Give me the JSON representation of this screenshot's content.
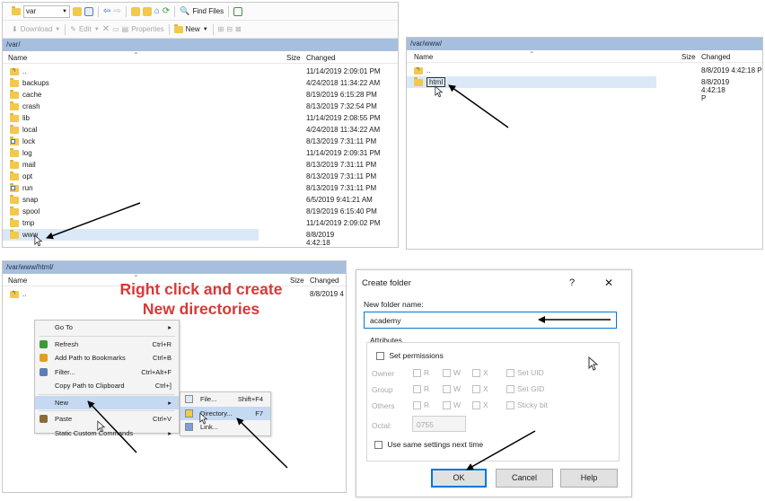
{
  "panel1": {
    "toolbar1": {
      "path_combo": "var",
      "find_files": "Find Files"
    },
    "toolbar2": {
      "download": "Download",
      "edit": "Edit",
      "properties": "Properties",
      "new": "New"
    },
    "path": "/var/",
    "headers": {
      "name": "Name",
      "size": "Size",
      "changed": "Changed"
    },
    "rows": [
      {
        "name": "..",
        "changed": "11/14/2019 2:09:01 PM",
        "icon": "parent-folder-icon"
      },
      {
        "name": "backups",
        "changed": "4/24/2018 11:34:22 AM",
        "icon": "folder-icon"
      },
      {
        "name": "cache",
        "changed": "8/19/2019 6:15:28 PM",
        "icon": "folder-icon"
      },
      {
        "name": "crash",
        "changed": "8/13/2019 7:32:54 PM",
        "icon": "folder-icon"
      },
      {
        "name": "lib",
        "changed": "11/14/2019 2:08:55 PM",
        "icon": "folder-icon"
      },
      {
        "name": "local",
        "changed": "4/24/2018 11:34:22 AM",
        "icon": "folder-icon"
      },
      {
        "name": "lock",
        "changed": "8/13/2019 7:31:11 PM",
        "icon": "folder-link-icon"
      },
      {
        "name": "log",
        "changed": "11/14/2019 2:09:31 PM",
        "icon": "folder-icon"
      },
      {
        "name": "mail",
        "changed": "8/13/2019 7:31:11 PM",
        "icon": "folder-icon"
      },
      {
        "name": "opt",
        "changed": "8/13/2019 7:31:11 PM",
        "icon": "folder-icon"
      },
      {
        "name": "run",
        "changed": "8/13/2019 7:31:11 PM",
        "icon": "folder-link-icon"
      },
      {
        "name": "snap",
        "changed": "6/5/2019 9:41:21 AM",
        "icon": "folder-icon"
      },
      {
        "name": "spool",
        "changed": "8/19/2019 6:15:40 PM",
        "icon": "folder-icon"
      },
      {
        "name": "tmp",
        "changed": "11/14/2019 2:09:02 PM",
        "icon": "folder-icon"
      },
      {
        "name": "www",
        "changed": "8/8/2019 4:42:18 PM",
        "icon": "folder-icon"
      }
    ]
  },
  "panel2": {
    "path": "/var/www/",
    "headers": {
      "name": "Name",
      "size": "Size",
      "changed": "Changed"
    },
    "rows": [
      {
        "name": "..",
        "changed": "8/8/2019 4:42:18 P",
        "icon": "parent-folder-icon"
      },
      {
        "name": "html",
        "changed": "8/8/2019 4:42:18 P",
        "icon": "folder-icon"
      }
    ]
  },
  "panel3": {
    "path": "/var/www/html/",
    "headers": {
      "name": "Name",
      "size": "Size",
      "changed": "Changed"
    },
    "rows": [
      {
        "name": "..",
        "changed": "8/8/2019 4",
        "icon": "parent-folder-icon"
      }
    ],
    "annotation": {
      "line1": "Right click and create",
      "line2": "New directories",
      "color": "#d93838"
    },
    "context_menu": [
      {
        "label": "Go To",
        "shortcut": "",
        "submenu": true,
        "icon": ""
      },
      {
        "label": "Refresh",
        "shortcut": "Ctrl+R",
        "submenu": false,
        "icon": "refresh-icon"
      },
      {
        "label": "Add Path to Bookmarks",
        "shortcut": "Ctrl+B",
        "submenu": false,
        "icon": "bookmark-icon"
      },
      {
        "label": "Filter...",
        "shortcut": "Ctrl+Alt+F",
        "submenu": false,
        "icon": "filter-icon"
      },
      {
        "label": "Copy Path to Clipboard",
        "shortcut": "Ctrl+]",
        "submenu": false,
        "icon": ""
      },
      {
        "label": "New",
        "shortcut": "",
        "submenu": true,
        "icon": "",
        "highlighted": true
      },
      {
        "label": "Paste",
        "shortcut": "Ctrl+V",
        "submenu": false,
        "icon": "paste-icon"
      },
      {
        "label": "Static Custom Commands",
        "shortcut": "",
        "submenu": true,
        "icon": ""
      }
    ],
    "submenu": [
      {
        "label": "File...",
        "shortcut": "Shift+F4",
        "icon": "new-file-icon"
      },
      {
        "label": "Directory...",
        "shortcut": "F7",
        "icon": "new-folder-icon",
        "highlighted": true
      },
      {
        "label": "Link...",
        "shortcut": "",
        "icon": "link-icon"
      }
    ]
  },
  "dialog": {
    "title": "Create folder",
    "help": "?",
    "close": "✕",
    "name_label": "New folder name:",
    "name_value": "academy",
    "attributes_label": "Attributes",
    "set_permissions": "Set permissions",
    "perm_rows": [
      {
        "label": "Owner",
        "extra": "Set UID"
      },
      {
        "label": "Group",
        "extra": "Set GID"
      },
      {
        "label": "Others",
        "extra": "Sticky bit"
      }
    ],
    "perm_cols": [
      "R",
      "W",
      "X"
    ],
    "octal_label": "Octal:",
    "octal_value": "0755",
    "use_same": "Use same settings next time",
    "ok": "OK",
    "cancel": "Cancel",
    "help_button": "Help"
  },
  "colors": {
    "path_bar": "#a7bfde",
    "folder": "#f2c94c",
    "accent": "#0078d7",
    "annotation": "#d93838"
  }
}
